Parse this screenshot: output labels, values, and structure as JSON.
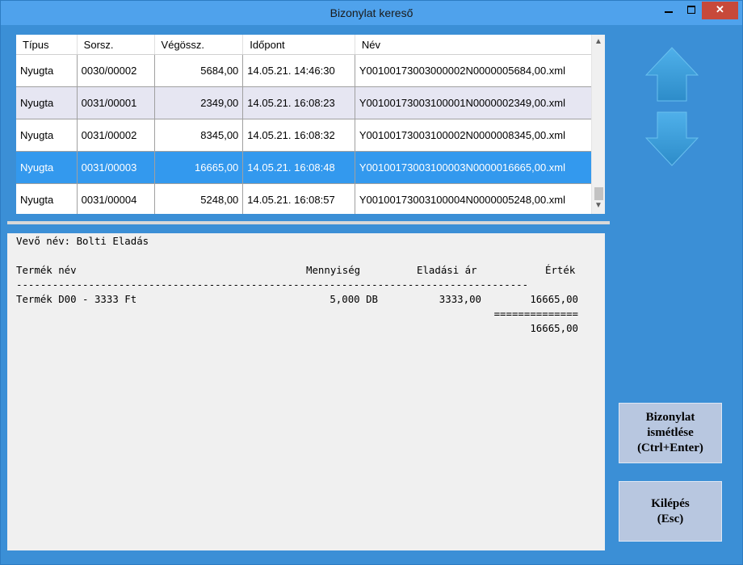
{
  "window": {
    "title": "Bizonylat kereső"
  },
  "grid": {
    "columns": [
      "Típus",
      "Sorsz.",
      "Végössz.",
      "Időpont",
      "Név"
    ],
    "rows": [
      [
        "Nyugta",
        "0030/00002",
        "5684,00",
        "14.05.21. 14:46:30",
        "Y00100173003000002N0000005684,00.xml"
      ],
      [
        "Nyugta",
        "0031/00001",
        "2349,00",
        "14.05.21. 16:08:23",
        "Y00100173003100001N0000002349,00.xml"
      ],
      [
        "Nyugta",
        "0031/00002",
        "8345,00",
        "14.05.21. 16:08:32",
        "Y00100173003100002N0000008345,00.xml"
      ],
      [
        "Nyugta",
        "0031/00003",
        "16665,00",
        "14.05.21. 16:08:48",
        "Y00100173003100003N0000016665,00.xml"
      ],
      [
        "Nyugta",
        "0031/00004",
        "5248,00",
        "14.05.21. 16:08:57",
        "Y00100173003100004N0000005248,00.xml"
      ]
    ]
  },
  "receipt": {
    "customer": "Vevő név: Bolti Eladás",
    "header_product": "Termék név",
    "header_qty": "Mennyiség",
    "header_price": "Eladási ár",
    "header_value": "Érték",
    "dashes": "-------------------------------------------------------------------------------------",
    "item_name": "Termék D00 - 3333 Ft",
    "item_qty": "5,000 DB",
    "item_price": "3333,00",
    "item_value": "16665,00",
    "equals": "==============",
    "total": "16665,00"
  },
  "buttons": {
    "reprint_line1": "Bizonylat",
    "reprint_line2": "ismétlése",
    "reprint_line3": "(Ctrl+Enter)",
    "exit_line1": "Kilépés",
    "exit_line2": "(Esc)"
  },
  "icons": {
    "up": "arrow-up-icon",
    "down": "arrow-down-icon",
    "minimize": "minimize-icon",
    "maximize": "maximize-icon",
    "close": "close-icon"
  },
  "colors": {
    "window_bg": "#3b8fd6",
    "titlebar": "#4fa2ec",
    "selected_row": "#3399ee",
    "button_bg": "#b8c7e0",
    "close_button": "#c7493a"
  }
}
